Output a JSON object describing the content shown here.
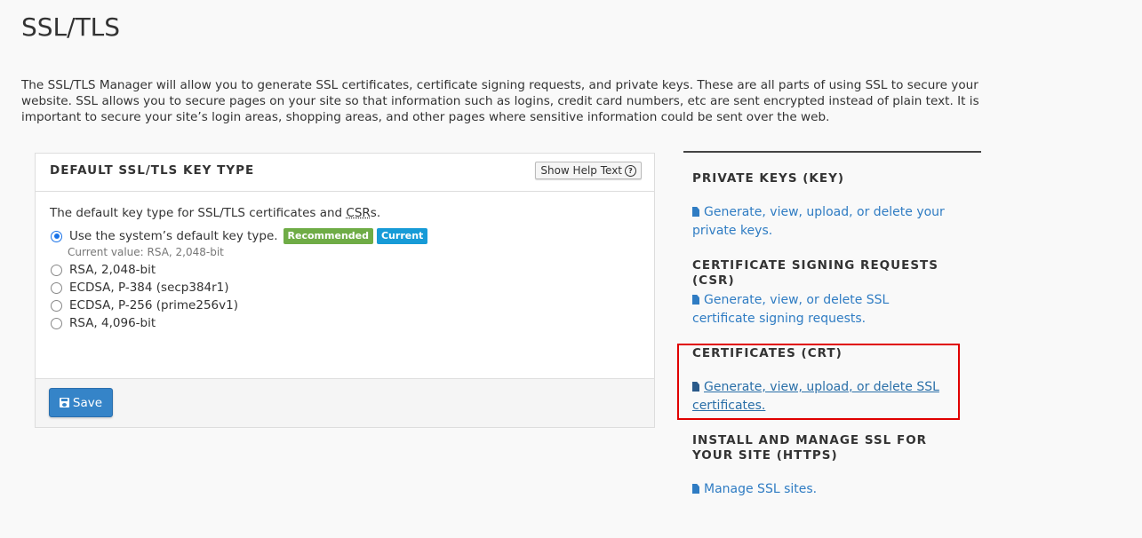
{
  "page": {
    "title": "SSL/TLS",
    "intro": "The SSL/TLS Manager will allow you to generate SSL certificates, certificate signing requests, and private keys. These are all parts of using SSL to secure your website. SSL allows you to secure pages on your site so that information such as logins, credit card numbers, etc are sent encrypted instead of plain text. It is important to secure your site’s login areas, shopping areas, and other pages where sensitive information could be sent over the web."
  },
  "panel": {
    "title": "DEFAULT SSL/TLS KEY TYPE",
    "help_button": "Show Help Text",
    "description_prefix": "The default key type for SSL/TLS certificates and ",
    "description_abbr": "CSR",
    "description_suffix": "s.",
    "options": [
      {
        "label": "Use the system’s default key type.",
        "checked": true
      },
      {
        "label": "RSA, 2,048-bit",
        "checked": false
      },
      {
        "label": "ECDSA, P-384 (secp384r1)",
        "checked": false
      },
      {
        "label": "ECDSA, P-256 (prime256v1)",
        "checked": false
      },
      {
        "label": "RSA, 4,096-bit",
        "checked": false
      }
    ],
    "badges": {
      "recommended": "Recommended",
      "current": "Current"
    },
    "current_value": "Current value: RSA, 2,048-bit",
    "save_label": "Save"
  },
  "sidebar": {
    "sections": [
      {
        "heading": "PRIVATE KEYS (KEY)",
        "link": "Generate, view, upload, or delete your private keys."
      },
      {
        "heading": "CERTIFICATE SIGNING REQUESTS (CSR)",
        "link": "Generate, view, or delete SSL certificate signing requests."
      },
      {
        "heading": "CERTIFICATES (CRT)",
        "link": "Generate, view, upload, or delete SSL certificates."
      },
      {
        "heading": "INSTALL AND MANAGE SSL FOR YOUR SITE (HTTPS)",
        "link": "Manage SSL sites."
      }
    ]
  },
  "colors": {
    "link": "#2f7cc3",
    "save_button": "#3584c8",
    "badge_recommended": "#6fac46",
    "badge_current": "#179bd7",
    "highlight": "#e00000"
  }
}
